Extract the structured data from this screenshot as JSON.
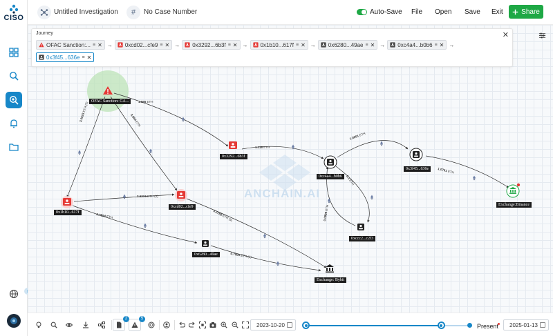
{
  "app": {
    "logo_text": "CISO"
  },
  "header": {
    "investigation_title": "Untitled Investigation",
    "case_icon_glyph": "#",
    "case_title": "No Case Number",
    "autosave_label": "Auto-Save",
    "autosave_on": true,
    "menu": {
      "file": "File",
      "open": "Open",
      "save": "Save",
      "exit": "Exit"
    },
    "share_label": "Share",
    "accent_color": "#1ea845"
  },
  "sidebar": {
    "items": [
      {
        "name": "dashboard-icon",
        "active": false
      },
      {
        "name": "wallet-search-icon",
        "active": false
      },
      {
        "name": "investigation-icon",
        "active": true
      },
      {
        "name": "alerts-bell-icon",
        "active": false
      },
      {
        "name": "cases-folder-icon",
        "active": false
      }
    ],
    "bottom": [
      "globe-icon",
      "user-avatar"
    ],
    "accent_color": "#1787c8"
  },
  "journey": {
    "title": "Journey",
    "chips": [
      {
        "label": "OFAC Sanction:...",
        "icon": "warning-icon",
        "color": "#e53935",
        "selected": false
      },
      {
        "label": "0xcd02...cfe9",
        "icon": "wallet-icon",
        "color": "#e53935",
        "selected": false
      },
      {
        "label": "0x3292...6b3f",
        "icon": "wallet-icon",
        "color": "#e53935",
        "selected": false
      },
      {
        "label": "0x1b10...617f",
        "icon": "wallet-icon",
        "color": "#e53935",
        "selected": false
      },
      {
        "label": "0x6280...49ae",
        "icon": "wallet-icon",
        "color": "#444444",
        "selected": false
      },
      {
        "label": "0xc4a4...b0b6",
        "icon": "wallet-icon",
        "color": "#444444",
        "selected": false
      },
      {
        "label": "0x3f45...636e",
        "icon": "wallet-icon",
        "color": "#444444",
        "selected": true
      }
    ]
  },
  "graph": {
    "watermark": "ANCHAIN.AI",
    "nodes": [
      {
        "id": "ofac",
        "label": "OFAC Sanction: GA...",
        "kind": "sanction",
        "color": "#e53935"
      },
      {
        "id": "n3292",
        "label": "0x3292...6b3f",
        "kind": "wallet",
        "color": "#e53935"
      },
      {
        "id": "n1b10",
        "label": "0x1b10...617f",
        "kind": "wallet",
        "color": "#e53935"
      },
      {
        "id": "ncd02",
        "label": "0xcd02...cfe9",
        "kind": "wallet",
        "color": "#e53935"
      },
      {
        "id": "nc4a4",
        "label": "0xc4a4...b0b6",
        "kind": "wallet",
        "color": "#222222"
      },
      {
        "id": "n3f45",
        "label": "0x3f45...636e",
        "kind": "wallet",
        "color": "#222222"
      },
      {
        "id": "nccc2",
        "label": "0xccc2...c2f3",
        "kind": "wallet",
        "color": "#222222"
      },
      {
        "id": "n6280",
        "label": "0x6280...49ae",
        "kind": "wallet",
        "color": "#222222"
      },
      {
        "id": "bybit",
        "label": "Exchange: Bybit",
        "kind": "exchange",
        "color": "#222222"
      },
      {
        "id": "binance",
        "label": "Exchange:Binance",
        "kind": "exchange",
        "color": "#1ea845"
      }
    ],
    "edges": [
      {
        "from": "ofac",
        "to": "n3292",
        "amount": "1.066",
        "unit": "ETH"
      },
      {
        "from": "ofac",
        "to": "n1b10",
        "amount": "3.6023",
        "unit": "ETH (5)"
      },
      {
        "from": "ofac",
        "to": "ncd02",
        "amount": "0.864",
        "unit": "ETH"
      },
      {
        "from": "n3292",
        "to": "nc4a4",
        "amount": "1.118",
        "unit": "ETH"
      },
      {
        "from": "n1b10",
        "to": "ncd02",
        "amount": "3.6274",
        "unit": "ETH (4)"
      },
      {
        "from": "n1b10",
        "to": "n6280",
        "amount": "0.7594",
        "unit": "ETH"
      },
      {
        "from": "ncd02",
        "to": "bybit",
        "amount": "3.2788",
        "unit": "ETH (5)"
      },
      {
        "from": "n6280",
        "to": "bybit",
        "amount": "0.7505",
        "unit": "ETH (2)"
      },
      {
        "from": "nc4a4",
        "to": "n3f45",
        "amount": "1.0801",
        "unit": "ETH"
      },
      {
        "from": "nc4a4",
        "to": "nccc2",
        "amount": "0.1",
        "unit": "ETH"
      },
      {
        "from": "nccc2",
        "to": "nc4a4",
        "amount": "0.0999",
        "unit": "ETH"
      },
      {
        "from": "n3f45",
        "to": "binance",
        "amount": "1.0761",
        "unit": "ETH"
      }
    ]
  },
  "toolbar": {
    "badges": {
      "notes": "2",
      "alerts": "5"
    },
    "start_date": "2023-10-20",
    "end_date": "2025-01-13",
    "present_label": "Present",
    "range_fill": 0.83
  }
}
